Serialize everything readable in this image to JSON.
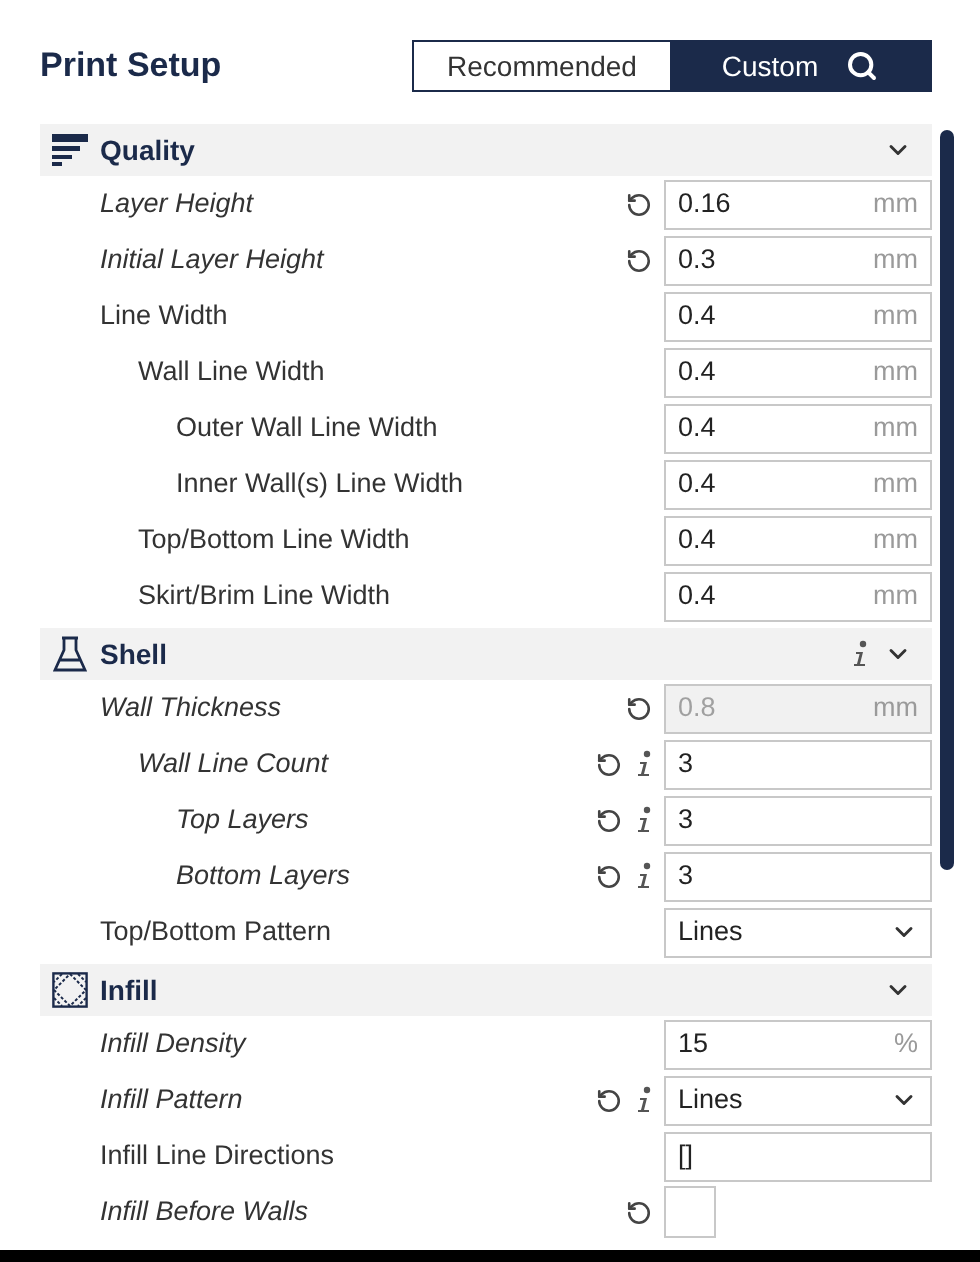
{
  "title": "Print Setup",
  "modes": [
    {
      "label": "Recommended",
      "selected": false
    },
    {
      "label": "Custom",
      "selected": true
    }
  ],
  "sections": [
    {
      "name": "Quality",
      "kind": "quality",
      "info": false,
      "expanded": true,
      "settings": [
        {
          "label": "Layer Height",
          "overridden": true,
          "reset": true,
          "info": false,
          "kind": "number",
          "value": "0.16",
          "unit": "mm",
          "disabled": false
        },
        {
          "label": "Initial Layer Height",
          "overridden": true,
          "reset": true,
          "info": false,
          "kind": "number",
          "value": "0.3",
          "unit": "mm",
          "disabled": false
        },
        {
          "label": "Line Width",
          "overridden": false,
          "reset": false,
          "info": false,
          "kind": "number",
          "value": "0.4",
          "unit": "mm",
          "disabled": false,
          "children": [
            {
              "label": "Wall Line Width",
              "overridden": false,
              "reset": false,
              "info": false,
              "kind": "number",
              "value": "0.4",
              "unit": "mm",
              "disabled": false,
              "children": [
                {
                  "label": "Outer Wall Line Width",
                  "overridden": false,
                  "reset": false,
                  "info": false,
                  "kind": "number",
                  "value": "0.4",
                  "unit": "mm",
                  "disabled": false
                },
                {
                  "label": "Inner Wall(s) Line Width",
                  "overridden": false,
                  "reset": false,
                  "info": false,
                  "kind": "number",
                  "value": "0.4",
                  "unit": "mm",
                  "disabled": false
                }
              ]
            },
            {
              "label": "Top/Bottom Line Width",
              "overridden": false,
              "reset": false,
              "info": false,
              "kind": "number",
              "value": "0.4",
              "unit": "mm",
              "disabled": false
            },
            {
              "label": "Skirt/Brim Line Width",
              "overridden": false,
              "reset": false,
              "info": false,
              "kind": "number",
              "value": "0.4",
              "unit": "mm",
              "disabled": false
            }
          ]
        }
      ]
    },
    {
      "name": "Shell",
      "kind": "shell",
      "info": true,
      "expanded": true,
      "settings": [
        {
          "label": "Wall Thickness",
          "overridden": true,
          "reset": true,
          "info": false,
          "kind": "number",
          "value": "0.8",
          "unit": "mm",
          "disabled": true,
          "children": [
            {
              "label": "Wall Line Count",
              "overridden": true,
              "reset": true,
              "info": true,
              "kind": "number",
              "value": "3",
              "disabled": false,
              "children": [
                {
                  "label": "Top Layers",
                  "overridden": true,
                  "reset": true,
                  "info": true,
                  "kind": "number",
                  "value": "3",
                  "disabled": false
                },
                {
                  "label": "Bottom Layers",
                  "overridden": true,
                  "reset": true,
                  "info": true,
                  "kind": "number",
                  "value": "3",
                  "disabled": false
                }
              ]
            }
          ]
        },
        {
          "label": "Top/Bottom Pattern",
          "overridden": false,
          "reset": false,
          "info": false,
          "kind": "select",
          "value": "Lines",
          "disabled": false
        }
      ]
    },
    {
      "name": "Infill",
      "kind": "infill",
      "info": false,
      "expanded": true,
      "settings": [
        {
          "label": "Infill Density",
          "overridden": true,
          "reset": false,
          "info": false,
          "kind": "number",
          "value": "15",
          "unit": "%",
          "disabled": false
        },
        {
          "label": "Infill Pattern",
          "overridden": true,
          "reset": true,
          "info": true,
          "kind": "select",
          "value": "Lines",
          "disabled": false
        },
        {
          "label": "Infill Line Directions",
          "overridden": false,
          "reset": false,
          "info": false,
          "kind": "number",
          "value": "[]",
          "disabled": false
        },
        {
          "label": "Infill Before Walls",
          "overridden": true,
          "reset": true,
          "info": false,
          "kind": "checkbox",
          "checked": false,
          "disabled": false
        }
      ]
    }
  ]
}
